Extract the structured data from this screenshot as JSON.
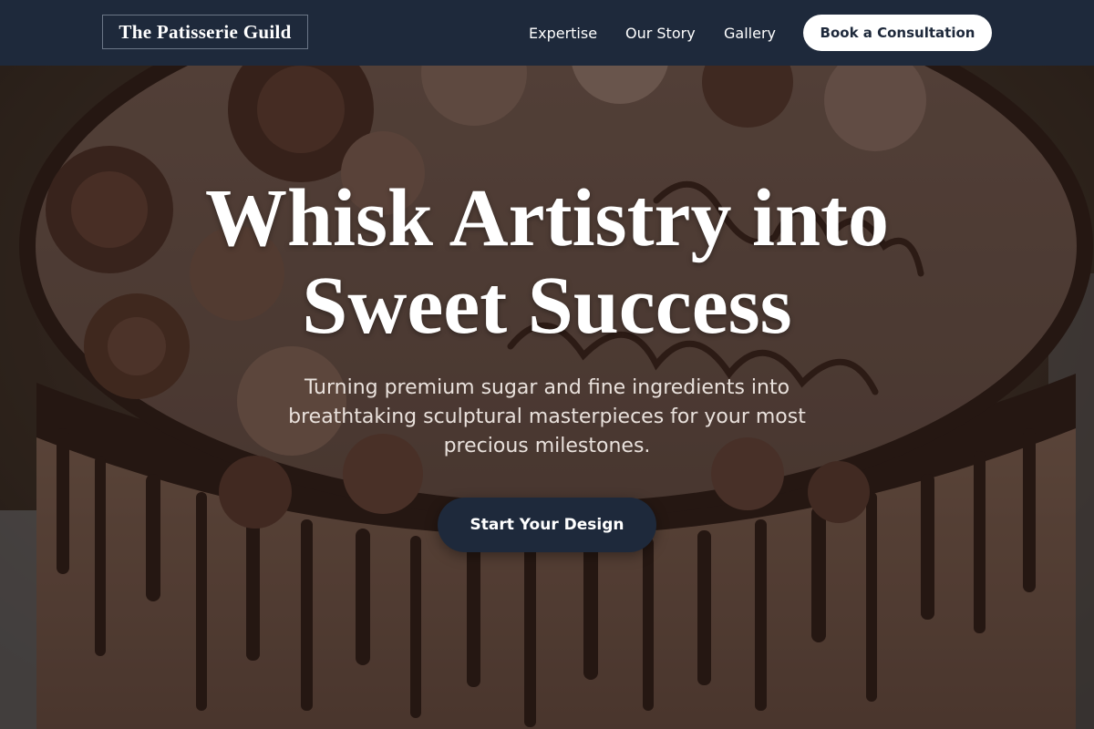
{
  "header": {
    "brand": "The Patisserie Guild",
    "nav": [
      "Expertise",
      "Our Story",
      "Gallery"
    ],
    "cta_label": "Book a Consultation"
  },
  "hero": {
    "title_line1": "Whisk Artistry into",
    "title_line2": "Sweet Success",
    "subtitle": "Turning premium sugar and fine ingredients into breathtaking sculptural masterpieces for your most precious milestones.",
    "cta_label": "Start Your Design",
    "background": "chocolate-drip-cake-photo"
  },
  "colors": {
    "header_bg": "#1e293b",
    "brand_border": "#6b7687",
    "cta_light": "#ffffff",
    "cta_dark": "#1e293b"
  }
}
